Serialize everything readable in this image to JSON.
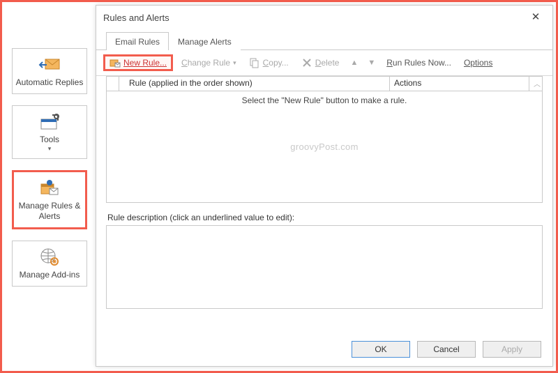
{
  "ribbon": {
    "automatic_replies": "Automatic Replies",
    "tools": "Tools",
    "manage_rules": "Manage Rules & Alerts",
    "manage_addins": "Manage Add-ins"
  },
  "dialog": {
    "title": "Rules and Alerts",
    "tabs": {
      "email_rules": "Email Rules",
      "manage_alerts": "Manage Alerts"
    },
    "toolbar": {
      "new_rule": "New Rule...",
      "change_rule": "Change Rule",
      "copy": "Copy...",
      "delete": "Delete",
      "run_rules_now": "Run Rules Now...",
      "options": "Options"
    },
    "columns": {
      "rule": "Rule (applied in the order shown)",
      "actions": "Actions"
    },
    "empty_hint": "Select the \"New Rule\" button to make a rule.",
    "watermark": "groovyPost.com",
    "description_label": "Rule description (click an underlined value to edit):",
    "buttons": {
      "ok": "OK",
      "cancel": "Cancel",
      "apply": "Apply"
    }
  }
}
